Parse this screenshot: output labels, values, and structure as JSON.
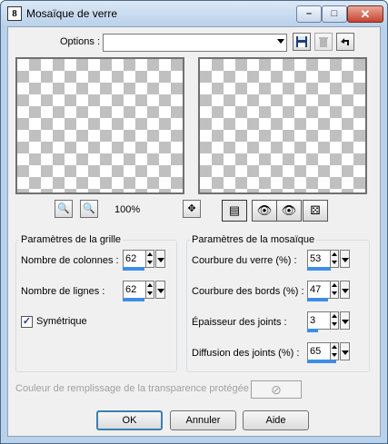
{
  "window": {
    "title": "Mosaïque de verre",
    "app_icon": "8"
  },
  "toolbar": {
    "options_label": "Options :",
    "options_value": ""
  },
  "zoom": "100%",
  "grid": {
    "legend": "Paramètres de la grille",
    "columns_label": "Nombre de colonnes :",
    "columns_value": "62",
    "rows_label": "Nombre de lignes :",
    "rows_value": "62",
    "symmetric_label": "Symétrique",
    "symmetric_checked": true
  },
  "mosaic": {
    "legend": "Paramètres de la mosaïque",
    "glass_curve_label": "Courbure du verre (%) :",
    "glass_curve_value": "53",
    "edge_curve_label": "Courbure des bords (%) :",
    "edge_curve_value": "47",
    "joint_thickness_label": "Épaisseur des joints :",
    "joint_thickness_value": "3",
    "joint_diffusion_label": "Diffusion des joints (%) :",
    "joint_diffusion_value": "65"
  },
  "fill": {
    "label": "Couleur de remplissage de la transparence protégée :"
  },
  "buttons": {
    "ok": "OK",
    "cancel": "Annuler",
    "help": "Aide"
  },
  "colors": {
    "accent_bar": "#3c8ee6",
    "window_frame": "#b9d1ea",
    "close_button": "#c7432f"
  }
}
